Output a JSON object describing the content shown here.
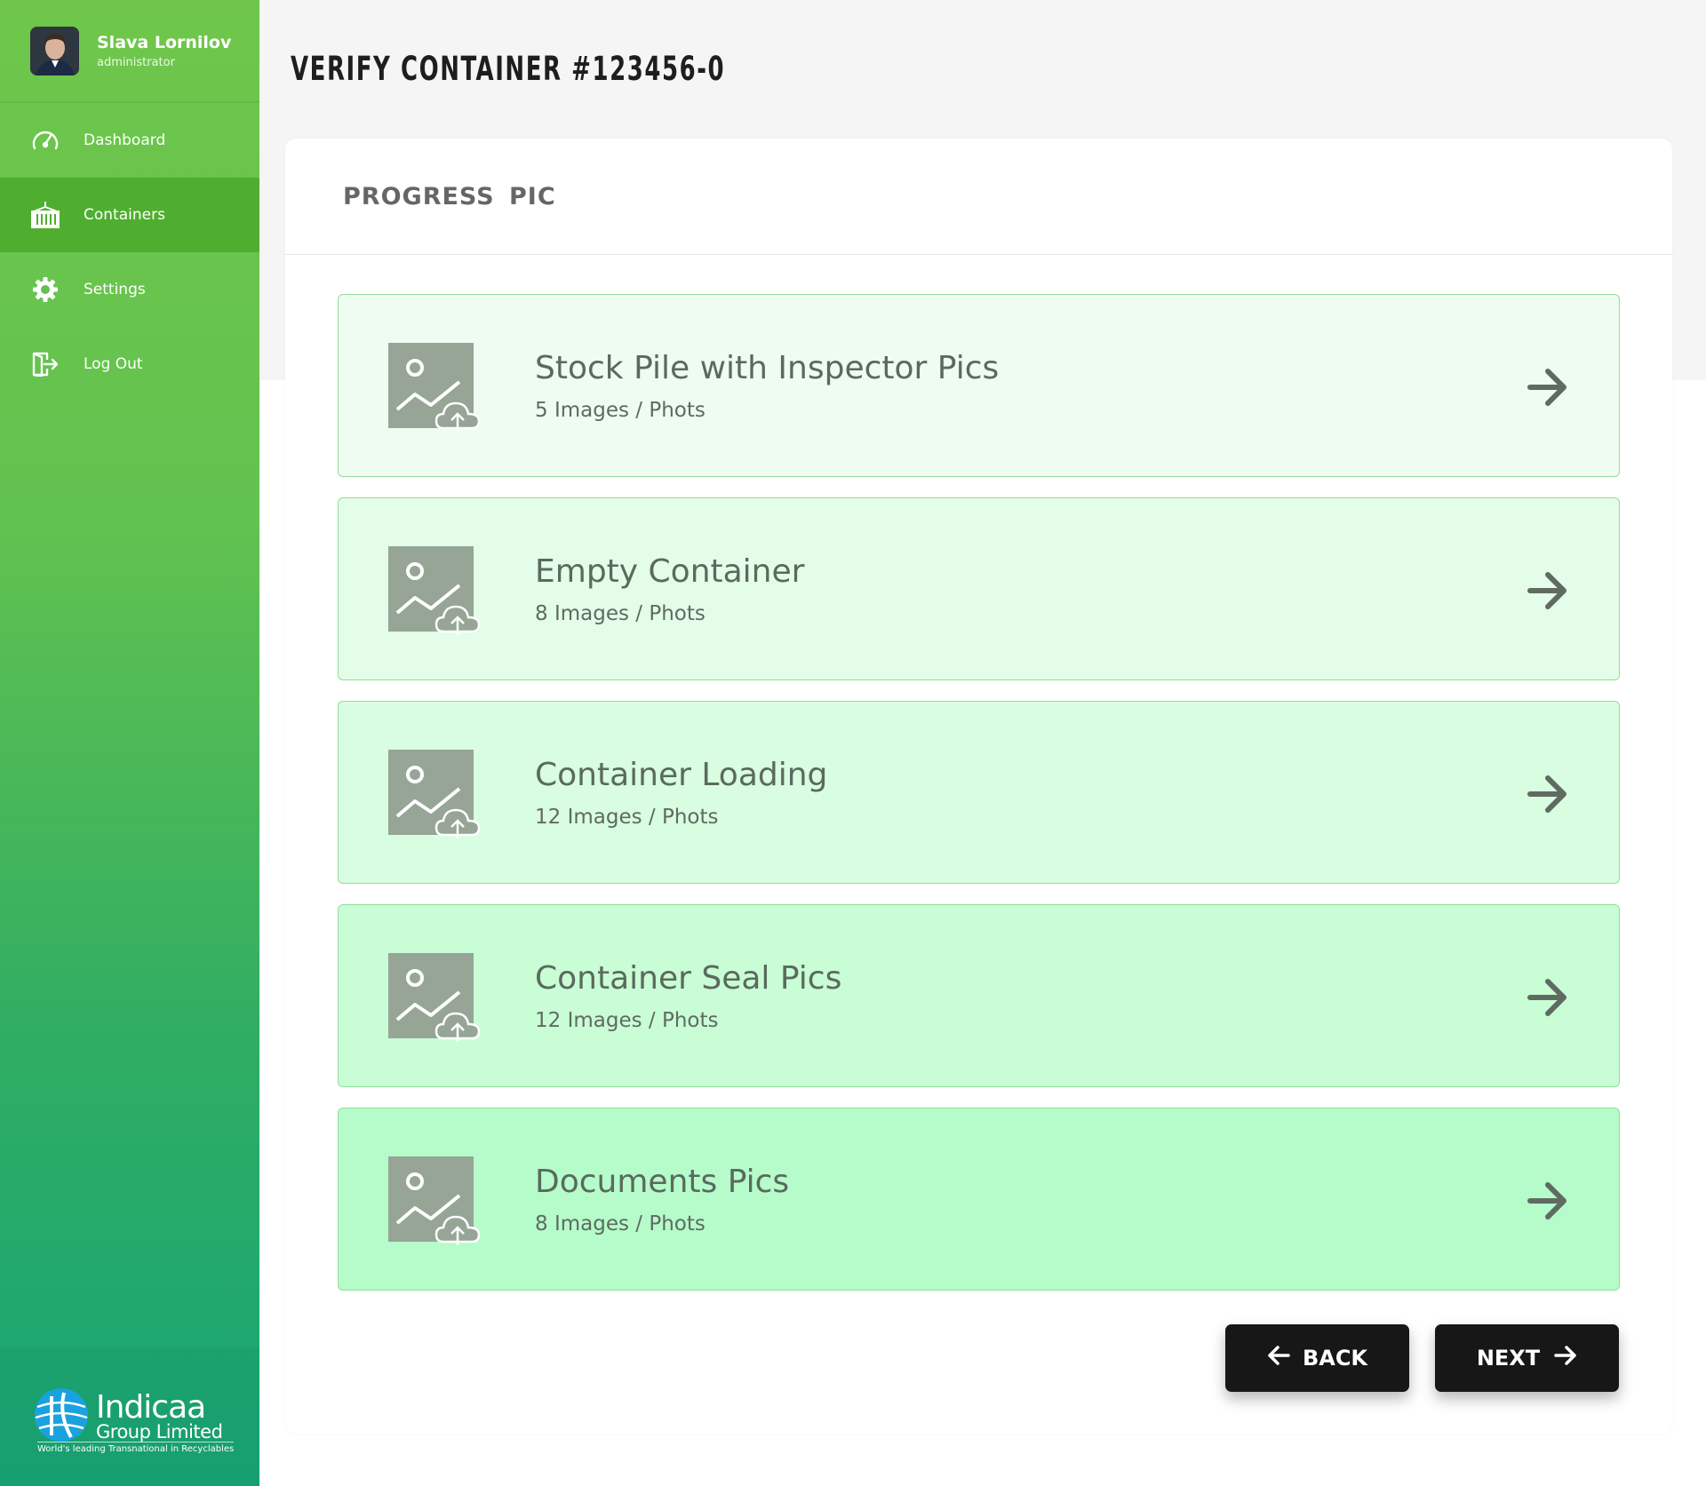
{
  "user": {
    "name": "Slava Lornilov",
    "role": "administrator"
  },
  "nav": {
    "items": [
      {
        "label": "Dashboard",
        "icon": "gauge-icon"
      },
      {
        "label": "Containers",
        "icon": "container-icon",
        "active": true
      },
      {
        "label": "Settings",
        "icon": "gear-icon"
      },
      {
        "label": "Log Out",
        "icon": "logout-icon"
      }
    ]
  },
  "brand": {
    "name": "Indicaa",
    "sub": "Group Limited",
    "tagline": "World's leading Transnational in Recyclables"
  },
  "page": {
    "title": "VERIFY CONTAINER #123456-0"
  },
  "section": {
    "title": "PROGRESS PIC"
  },
  "uploads": [
    {
      "title": "Stock Pile with Inspector Pics",
      "count": "5 Images / Phots",
      "bg": "#effcf1"
    },
    {
      "title": "Empty Container",
      "count": "8 Images / Phots",
      "bg": "#e3fde8"
    },
    {
      "title": "Container Loading",
      "count": "12 Images / Phots",
      "bg": "#d8fde0"
    },
    {
      "title": "Container Seal Pics",
      "count": "12 Images / Phots",
      "bg": "#c8fdd6"
    },
    {
      "title": "Documents Pics",
      "count": "8 Images / Phots",
      "bg": "#b5fcca"
    }
  ],
  "buttons": {
    "back": "BACK",
    "next": "NEXT"
  },
  "colors": {
    "sidebar_top": "#6fc64b",
    "sidebar_bottom": "#17a576",
    "active_nav": "#4fae2f",
    "button": "#171717",
    "icon_gray": "#96a596"
  }
}
